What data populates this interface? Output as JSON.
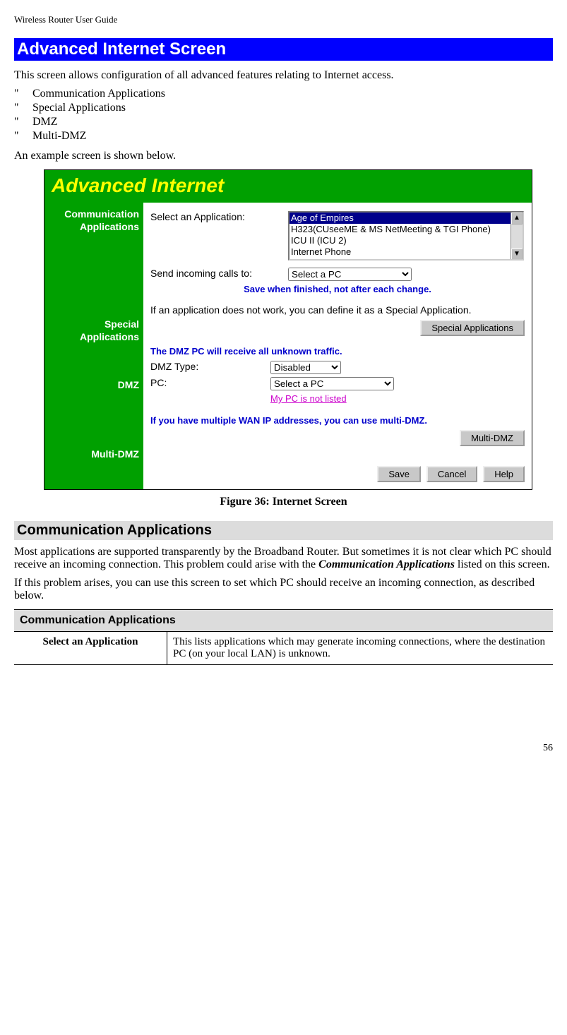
{
  "header": "Wireless Router User Guide",
  "page_number": "56",
  "section_title": "Advanced Internet Screen",
  "intro": "This screen allows configuration of all advanced features relating to Internet access.",
  "bullets": {
    "mark": "\"",
    "items": [
      "Communication Applications",
      "Special Applications",
      "DMZ",
      "Multi-DMZ"
    ]
  },
  "example_line": "An example screen is shown below.",
  "figure": {
    "title": "Advanced Internet",
    "side_labels": {
      "comm1": "Communication",
      "comm2": "Applications",
      "special1": "Special",
      "special2": "Applications",
      "dmz": "DMZ",
      "multi": "Multi-DMZ"
    },
    "comm": {
      "select_label": "Select an Application:",
      "options": [
        "Age of Empires",
        "H323(CUseeME & MS NetMeeting & TGI Phone)",
        "ICU II (ICU 2)",
        "Internet Phone"
      ],
      "send_label": "Send incoming calls to:",
      "send_selected": "Select a PC",
      "save_note": "Save when finished, not after each change."
    },
    "special": {
      "text": "If an application does not work, you can define it as a Special Application.",
      "button": "Special Applications"
    },
    "dmz": {
      "note": "The DMZ PC will receive all unknown traffic.",
      "type_label": "DMZ Type:",
      "type_selected": "Disabled",
      "pc_label": "PC:",
      "pc_selected": "Select a PC",
      "link": "My PC is not listed"
    },
    "multi": {
      "note": "If you have multiple WAN IP addresses, you can use multi-DMZ.",
      "button": "Multi-DMZ"
    },
    "buttons": {
      "save": "Save",
      "cancel": "Cancel",
      "help": "Help"
    },
    "caption": "Figure 36: Internet Screen"
  },
  "comm_section": {
    "heading": "Communication Applications",
    "para1a": "Most applications are supported transparently by the Broadband Router. But sometimes it is not clear which PC should receive an incoming connection. This problem could arise with the ",
    "para1b": "Communication Applications",
    "para1c": " listed on this screen.",
    "para2": "If this problem arises, you can use this screen to set which PC should receive an incoming connection, as described below.",
    "table": {
      "header": "Communication Applications",
      "row1_label": "Select an Application",
      "row1_text": "This lists applications which may generate incoming connections, where the destination PC (on your local LAN) is unknown."
    }
  }
}
